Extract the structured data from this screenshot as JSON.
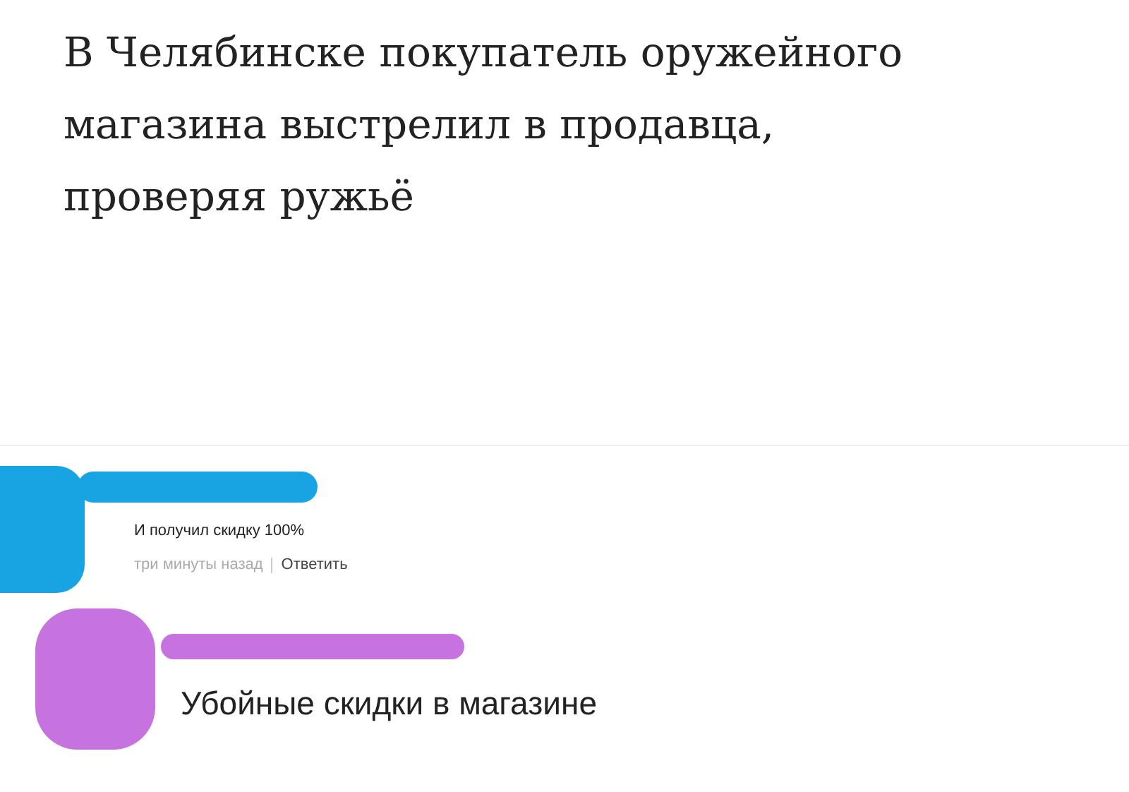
{
  "headline": "В Челябинске покупатель оружейного магазина выстрелил в продавца, проверяя ружьё",
  "comments": [
    {
      "kind": "small",
      "color": "#18a3e3",
      "text": "И получил скидку 100%",
      "time": "три минуты назад",
      "reply": "Ответить"
    },
    {
      "kind": "large",
      "color": "#c673e0",
      "text": "Убойные скидки в магазине"
    }
  ]
}
